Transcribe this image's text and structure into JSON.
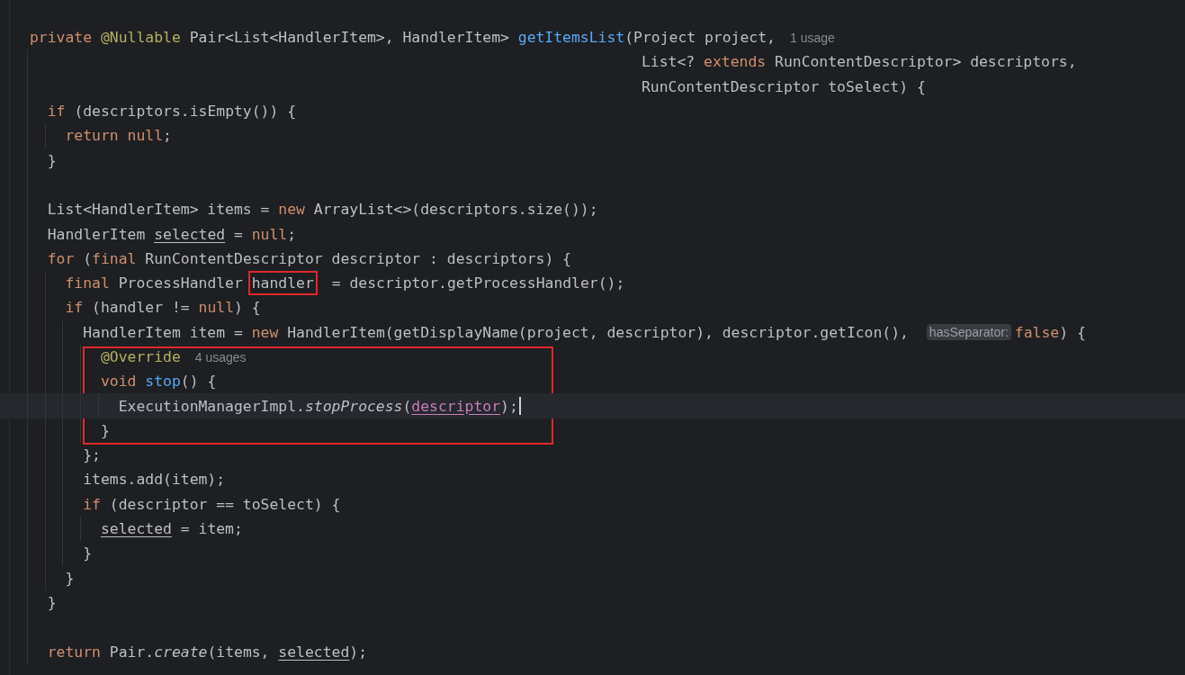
{
  "lines": [
    {
      "kind": "code",
      "tokens": [
        {
          "kind": "keyword",
          "text": "private "
        },
        {
          "kind": "annotation",
          "text": "@Nullable"
        },
        {
          "kind": "plain",
          "text": " Pair<List<HandlerItem>, HandlerItem> "
        },
        {
          "kind": "method",
          "text": "getItemsList"
        },
        {
          "kind": "plain",
          "text": "(Project project,"
        },
        {
          "kind": "usage-hint",
          "text": "1 usage"
        }
      ]
    },
    {
      "kind": "continuation",
      "tokens": [
        {
          "kind": "plain",
          "text": "List<? "
        },
        {
          "kind": "keyword",
          "text": "extends"
        },
        {
          "kind": "plain",
          "text": " RunContentDescriptor> descriptors,"
        }
      ]
    },
    {
      "kind": "continuation",
      "tokens": [
        {
          "kind": "plain",
          "text": "RunContentDescriptor toSelect) {"
        }
      ]
    },
    {
      "kind": "code",
      "tokens": [
        {
          "kind": "keyword",
          "text": "  if"
        },
        {
          "kind": "plain",
          "text": " (descriptors.isEmpty()) {"
        }
      ]
    },
    {
      "kind": "code",
      "tokens": [
        {
          "kind": "keyword",
          "text": "    return null"
        },
        {
          "kind": "plain",
          "text": ";"
        }
      ]
    },
    {
      "kind": "code",
      "tokens": [
        {
          "kind": "plain",
          "text": "  }"
        }
      ]
    },
    {
      "kind": "blank"
    },
    {
      "kind": "code",
      "tokens": [
        {
          "kind": "plain",
          "text": "  List<HandlerItem> items = "
        },
        {
          "kind": "keyword",
          "text": "new"
        },
        {
          "kind": "plain",
          "text": " ArrayList<>(descriptors.size());"
        }
      ]
    },
    {
      "kind": "code",
      "tokens": [
        {
          "kind": "plain",
          "text": "  HandlerItem "
        },
        {
          "kind": "reassigned",
          "text": "selected"
        },
        {
          "kind": "plain",
          "text": " = "
        },
        {
          "kind": "keyword",
          "text": "null"
        },
        {
          "kind": "plain",
          "text": ";"
        }
      ]
    },
    {
      "kind": "code",
      "tokens": [
        {
          "kind": "keyword",
          "text": "  for"
        },
        {
          "kind": "plain",
          "text": " ("
        },
        {
          "kind": "keyword",
          "text": "final"
        },
        {
          "kind": "plain",
          "text": " RunContentDescriptor descriptor : descriptors) {"
        }
      ]
    },
    {
      "kind": "code",
      "tokens": [
        {
          "kind": "keyword",
          "text": "    final"
        },
        {
          "kind": "plain",
          "text": " ProcessHandler "
        },
        {
          "kind": "plain",
          "text": "handler",
          "boxed": true
        },
        {
          "kind": "plain",
          "text": " = descriptor.getProcessHandler();"
        }
      ]
    },
    {
      "kind": "code",
      "tokens": [
        {
          "kind": "keyword",
          "text": "    if"
        },
        {
          "kind": "plain",
          "text": " (handler != "
        },
        {
          "kind": "keyword",
          "text": "null"
        },
        {
          "kind": "plain",
          "text": ") {"
        }
      ]
    },
    {
      "kind": "code",
      "tokens": [
        {
          "kind": "plain",
          "text": "      HandlerItem item = "
        },
        {
          "kind": "keyword",
          "text": "new"
        },
        {
          "kind": "plain",
          "text": " HandlerItem(getDisplayName(project, descriptor), descriptor.getIcon(), "
        },
        {
          "kind": "parameter-hint",
          "text": "hasSeparator:"
        },
        {
          "kind": "keyword",
          "text": "false"
        },
        {
          "kind": "plain",
          "text": ") {"
        }
      ]
    },
    {
      "kind": "boxed",
      "lines": [
        {
          "kind": "code",
          "tokens": [
            {
              "kind": "annotation",
              "text": "        @Override"
            },
            {
              "kind": "usage-hint",
              "text": "4 usages"
            }
          ]
        },
        {
          "kind": "code",
          "tokens": [
            {
              "kind": "keyword",
              "text": "        void"
            },
            {
              "kind": "method",
              "text": " stop"
            },
            {
              "kind": "plain",
              "text": "() {"
            }
          ]
        },
        {
          "kind": "code",
          "current": true,
          "tokens": [
            {
              "kind": "plain",
              "text": "          ExecutionManagerImpl."
            },
            {
              "kind": "static",
              "text": "stopProcess"
            },
            {
              "kind": "plain",
              "text": "("
            },
            {
              "kind": "field",
              "text": "descriptor"
            },
            {
              "kind": "plain",
              "text": ");"
            }
          ]
        },
        {
          "kind": "code",
          "tokens": [
            {
              "kind": "plain",
              "text": "        }"
            }
          ]
        }
      ]
    },
    {
      "kind": "code",
      "tokens": [
        {
          "kind": "plain",
          "text": "      };"
        }
      ]
    },
    {
      "kind": "code",
      "tokens": [
        {
          "kind": "plain",
          "text": "      items.add(item);"
        }
      ]
    },
    {
      "kind": "code",
      "tokens": [
        {
          "kind": "keyword",
          "text": "      if"
        },
        {
          "kind": "plain",
          "text": " (descriptor == toSelect) {"
        }
      ]
    },
    {
      "kind": "code",
      "tokens": [
        {
          "kind": "reassigned",
          "text": "        selected"
        },
        {
          "kind": "plain",
          "text": " = item;"
        }
      ]
    },
    {
      "kind": "code",
      "tokens": [
        {
          "kind": "plain",
          "text": "      }"
        }
      ]
    },
    {
      "kind": "code",
      "tokens": [
        {
          "kind": "plain",
          "text": "    }"
        }
      ]
    },
    {
      "kind": "code",
      "tokens": [
        {
          "kind": "plain",
          "text": "  }"
        }
      ]
    },
    {
      "kind": "blank"
    },
    {
      "kind": "code",
      "tokens": [
        {
          "kind": "keyword",
          "text": "  return"
        },
        {
          "kind": "plain",
          "text": " Pair."
        },
        {
          "kind": "static",
          "text": "create"
        },
        {
          "kind": "plain",
          "text": "(items, "
        },
        {
          "kind": "reassigned",
          "text": "selected"
        },
        {
          "kind": "plain",
          "text": ");"
        }
      ]
    }
  ]
}
